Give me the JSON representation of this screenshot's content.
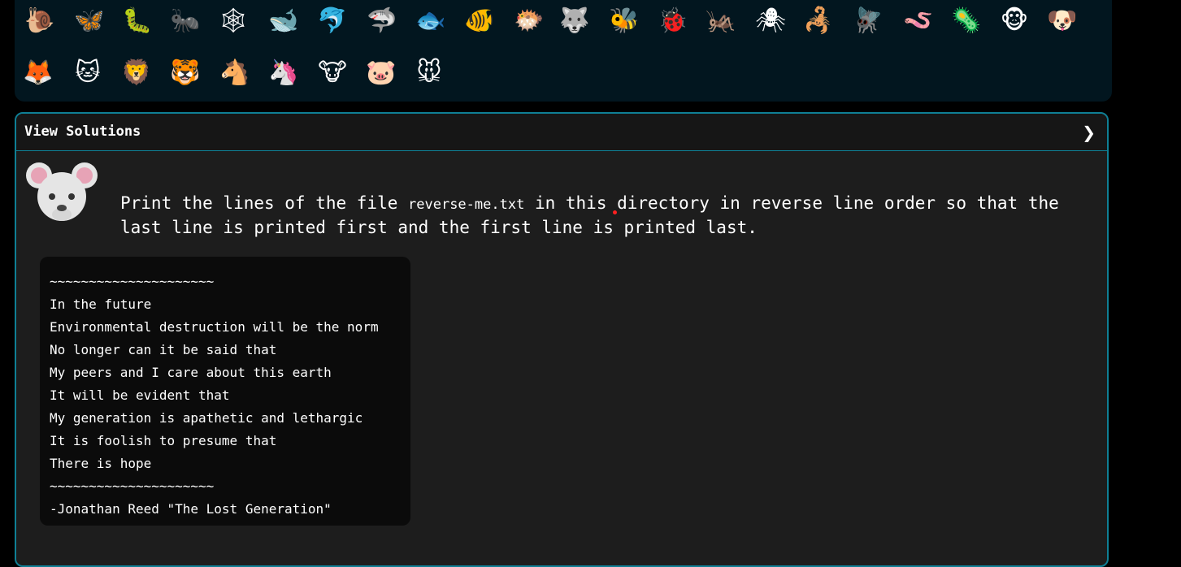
{
  "animals": [
    {
      "name": "snail",
      "glyph": "🐌"
    },
    {
      "name": "butterfly",
      "glyph": "🦋"
    },
    {
      "name": "caterpillar",
      "glyph": "🐛"
    },
    {
      "name": "ant",
      "glyph": "🐜"
    },
    {
      "name": "spider-web",
      "glyph": "🕸"
    },
    {
      "name": "whale",
      "glyph": "🐋"
    },
    {
      "name": "dolphin",
      "glyph": "🐬"
    },
    {
      "name": "shark",
      "glyph": "🦈"
    },
    {
      "name": "fish",
      "glyph": "🐟"
    },
    {
      "name": "tropical-fish",
      "glyph": "🐠"
    },
    {
      "name": "blowfish",
      "glyph": "🐡"
    },
    {
      "name": "wolf",
      "glyph": "🐺"
    },
    {
      "name": "bee",
      "glyph": "🐝"
    },
    {
      "name": "ladybug",
      "glyph": "🐞"
    },
    {
      "name": "cricket",
      "glyph": "🦗"
    },
    {
      "name": "spider",
      "glyph": "🕷"
    },
    {
      "name": "scorpion",
      "glyph": "🦂"
    },
    {
      "name": "fly",
      "glyph": "🪰"
    },
    {
      "name": "worm",
      "glyph": "🪱"
    },
    {
      "name": "microbe",
      "glyph": "🦠"
    },
    {
      "name": "monkey",
      "glyph": "🐵"
    },
    {
      "name": "dog",
      "glyph": "🐶"
    },
    {
      "name": "fox",
      "glyph": "🦊"
    },
    {
      "name": "cat",
      "glyph": "🐱"
    },
    {
      "name": "lion",
      "glyph": "🦁"
    },
    {
      "name": "tiger",
      "glyph": "🐯"
    },
    {
      "name": "horse",
      "glyph": "🐴"
    },
    {
      "name": "unicorn",
      "glyph": "🦄"
    },
    {
      "name": "cow",
      "glyph": "🐮"
    },
    {
      "name": "pig",
      "glyph": "🐷"
    },
    {
      "name": "mouse",
      "glyph": "🐭"
    }
  ],
  "solutions": {
    "title": "View Solutions",
    "chevron": "❯",
    "avatar_icon": "mouse-face-icon",
    "task_before": "Print the lines of the file ",
    "task_file": "reverse-me.txt",
    "task_after": " in this directory in reverse line order so that the last line is printed first and the first line is printed last.",
    "output_lines": [
      "~~~~~~~~~~~~~~~~~~~~~",
      "In the future",
      "Environmental destruction will be the norm",
      "No longer can it be said that",
      "My peers and I care about this earth",
      "It will be evident that",
      "My generation is apathetic and lethargic",
      "It is foolish to presume that",
      "There is hope",
      "~~~~~~~~~~~~~~~~~~~~~",
      "-Jonathan Reed \"The Lost Generation\""
    ]
  },
  "colors": {
    "page_bg": "#000000",
    "panel_bg": "#02161f",
    "accent_border": "#0f7f95",
    "content_bg": "#1d1d1d",
    "output_bg": "#0b0b0b"
  }
}
